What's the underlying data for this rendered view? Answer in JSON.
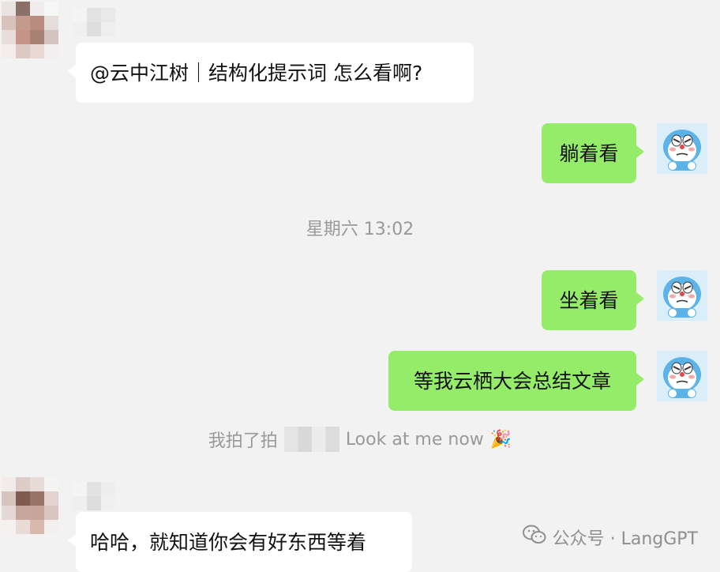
{
  "messages": [
    {
      "id": "m1",
      "side": "incoming",
      "text": "@云中江树｜结构化提示词 怎么看啊?"
    },
    {
      "id": "m2",
      "side": "outgoing",
      "text": "躺着看"
    },
    {
      "id": "m3",
      "side": "outgoing",
      "text": "坐着看"
    },
    {
      "id": "m4",
      "side": "outgoing",
      "text": "等我云栖大会总结文章"
    },
    {
      "id": "m5",
      "side": "incoming",
      "text": "哈哈，就知道你会有好东西等着"
    }
  ],
  "timestamp": "星期六 13:02",
  "system_notice": {
    "prefix": "我拍了拍",
    "suffix": "Look at me now",
    "emoji": "🎉"
  },
  "watermark": {
    "text": "公众号 · LangGPT",
    "icon": "wechat-icon"
  },
  "colors": {
    "background": "#f2f2f2",
    "incoming_bubble": "#ffffff",
    "outgoing_bubble": "#95ec69",
    "system_text": "#999999"
  }
}
